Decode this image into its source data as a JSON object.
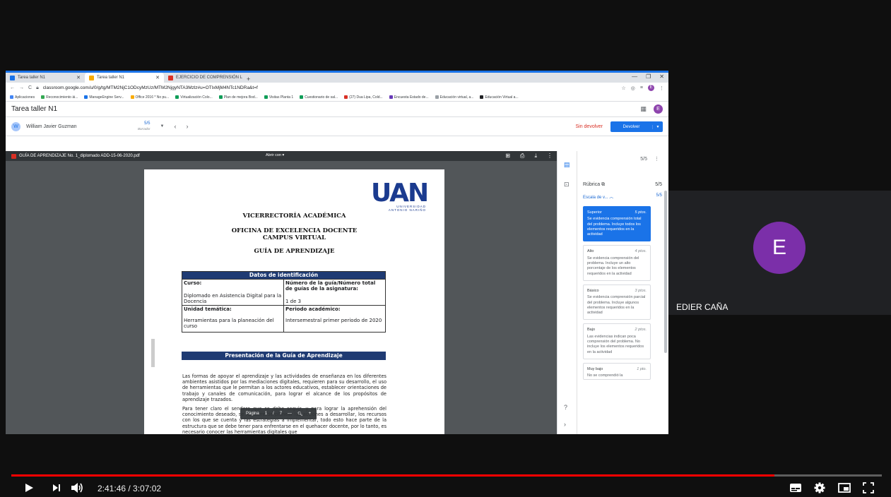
{
  "browser": {
    "tabs": [
      {
        "label": "Tarea taller N1",
        "color": "#1a73e8"
      },
      {
        "label": "Tarea taller N1",
        "color": "#f9ab00"
      },
      {
        "label": "EJERCICIO DE COMPRENSIÓN L",
        "color": "#d93025"
      }
    ],
    "url": "classroom.google.com/u/0/g/tg/MTM2NjC1ODcyMzUz/MTM2NjgyNTA3Mzlz#u=OTIxMjM4NTc1NDRa&t=f",
    "bookmarks": [
      {
        "label": "Aplicaciones",
        "color": "#4285f4"
      },
      {
        "label": "Reconocimiento ài...",
        "color": "#34a853"
      },
      {
        "label": "ManageEngine Serv...",
        "color": "#1a73e8"
      },
      {
        "label": "Office 2016 * No pu...",
        "color": "#f9ab00"
      },
      {
        "label": "Virtualización Colo...",
        "color": "#0f9d58"
      },
      {
        "label": "Plan de mejora Bod...",
        "color": "#0f9d58"
      },
      {
        "label": "Visitas Planta 1",
        "color": "#0f9d58"
      },
      {
        "label": "Cuestionario de sal...",
        "color": "#0f9d58"
      },
      {
        "label": "(27) Dua Lipa, Cold...",
        "color": "#d93025"
      },
      {
        "label": "Encuesta Estado de...",
        "color": "#673ab7"
      },
      {
        "label": "Educación virtual, a...",
        "color": "#9aa0a6"
      },
      {
        "label": "Educación Virtual a...",
        "color": "#202124"
      }
    ],
    "avatar_letter": "E"
  },
  "classroom": {
    "title": "Tarea taller N1",
    "avatar_letter": "E",
    "student": {
      "initial": "W",
      "name": "William Javier Guzman",
      "grade": "5/5",
      "grade_status": "Borrador"
    },
    "sin_devolver": "Sin devolver",
    "devolver": "Devolver"
  },
  "viewer": {
    "filename": "GUÍA DE APRENDIZAJE No. 1_diplomado ADD-15-06-2020.pdf",
    "open_with": "Abrir con",
    "logo": {
      "main": "UAN",
      "sub1": "UNIVERSIDAD",
      "sub2": "ANTONIO NARIÑO"
    },
    "heading1": "VICERRECTORÍA ACADÉMICA",
    "heading2": "OFICINA DE EXCELENCIA DOCENTE",
    "heading3": "CAMPUS VIRTUAL",
    "heading4": "GUÍA DE APRENDIZAJE",
    "table": {
      "header": "Datos de identificación",
      "curso_label": "Curso:",
      "curso_value": "Diplomado en Asistencia Digital para la Docencia",
      "numero_label": "Número de la guía/Número total de guías de la asignatura:",
      "numero_value": "1 de 3",
      "unidad_label": "Unidad temática:",
      "unidad_value": "Herramientas para la planeación del curso",
      "periodo_label": "Periodo académico:",
      "periodo_value": "Intersemestral primer periodo de 2020"
    },
    "presentation_header": "Presentación de la Guía de Aprendizaje",
    "paragraph1": "Las formas de apoyar el aprendizaje y las actividades de enseñanza en los diferentes ambientes asistidos por las mediaciones digitales, requieren para su desarrollo, el uso de herramientas que le permitan a los actores educativos, establecer orientaciones de trabajo y canales de comunicación, para lograr el alcance de los propósitos de aprendizaje trazados.",
    "paragraph2": "Para tener claro el sendero que se debe seguir, y para lograr la aprehensión del conocimiento deseado, se requiere de planear las acciones a desarrollar, los recursos con los que se cuenta y las estrategias a implementar, todo esto hace parte de la estructura que se debe tener para enfrentarse en el quehacer docente, por lo tanto, es necesario conocer las herramientas digitales que",
    "page_label": "Página",
    "page_current": "1",
    "page_sep": "/",
    "page_total": "7"
  },
  "rubric": {
    "total": "5/5",
    "label": "Rúbrica",
    "label_score": "5/5",
    "criterion": "Escala de v...",
    "criterion_score": "5/5",
    "levels": [
      {
        "name": "Superior",
        "points": "5 ptos.",
        "desc": "Se evidencia comprensión total del problema. Incluye todos los elementos requeridos en la actividad"
      },
      {
        "name": "Alto",
        "points": "4 ptos.",
        "desc": "Se evidencia comprensión del problema. Incluye un alto porcentaje de los elementos requeridos en la actividad"
      },
      {
        "name": "Básico",
        "points": "3 ptos.",
        "desc": "Se evidencia comprensión parcial del problema. Incluye algunos elementos requeridos en la actividad"
      },
      {
        "name": "Bajo",
        "points": "2 ptos.",
        "desc": "Las evidencias indican poca comprensión del problema. No incluye los elementos requeridos en la actividad"
      },
      {
        "name": "Muy bajo",
        "points": "1 pto.",
        "desc": "No se comprendió la"
      }
    ]
  },
  "participant": {
    "initial": "E",
    "name": "EDIER CAÑA"
  },
  "player": {
    "time": "2:41:46 / 3:07:02",
    "progress": 0.877
  }
}
